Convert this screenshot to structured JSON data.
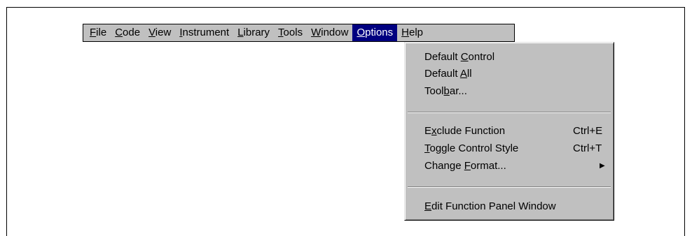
{
  "menubar": {
    "items": [
      {
        "pre": "",
        "u": "F",
        "post": "ile"
      },
      {
        "pre": "",
        "u": "C",
        "post": "ode"
      },
      {
        "pre": "",
        "u": "V",
        "post": "iew"
      },
      {
        "pre": "",
        "u": "I",
        "post": "nstrument"
      },
      {
        "pre": "",
        "u": "L",
        "post": "ibrary"
      },
      {
        "pre": "",
        "u": "T",
        "post": "ools"
      },
      {
        "pre": "",
        "u": "W",
        "post": "indow"
      },
      {
        "pre": "",
        "u": "O",
        "post": "ptions"
      },
      {
        "pre": "",
        "u": "H",
        "post": "elp"
      }
    ],
    "active_item": "Options"
  },
  "options_menu": {
    "items": [
      {
        "pre": "Default ",
        "u": "C",
        "post": "ontrol",
        "shortcut": ""
      },
      {
        "pre": "Default ",
        "u": "A",
        "post": "ll",
        "shortcut": ""
      },
      {
        "pre": "Tool",
        "u": "b",
        "post": "ar...",
        "shortcut": ""
      },
      {
        "pre": "E",
        "u": "x",
        "post": "clude Function",
        "shortcut": "Ctrl+E"
      },
      {
        "pre": "",
        "u": "T",
        "post": "oggle Control Style",
        "shortcut": "Ctrl+T"
      },
      {
        "pre": "Change ",
        "u": "F",
        "post": "ormat...",
        "shortcut": ""
      },
      {
        "pre": "",
        "u": "E",
        "post": "dit Function Panel Window",
        "shortcut": ""
      }
    ],
    "submenu_arrow_icon": "triangle-right-icon"
  },
  "colors": {
    "menu_background": "#c0c0c0",
    "highlight": "#000080",
    "highlight_text": "#ffffff"
  }
}
